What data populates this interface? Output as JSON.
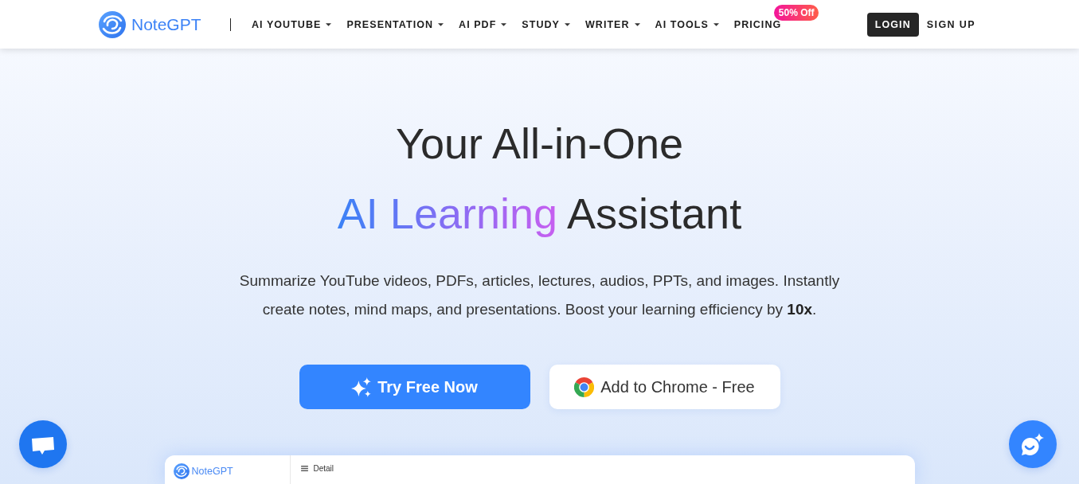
{
  "header": {
    "logo": "NoteGPT",
    "nav": [
      {
        "label": "AI YOUTUBE",
        "dropdown": true
      },
      {
        "label": "PRESENTATION",
        "dropdown": true
      },
      {
        "label": "AI PDF",
        "dropdown": true
      },
      {
        "label": "STUDY",
        "dropdown": true
      },
      {
        "label": "WRITER",
        "dropdown": true
      },
      {
        "label": "AI TOOLS",
        "dropdown": true
      },
      {
        "label": "PRICING",
        "dropdown": false,
        "badge": "50% Off"
      }
    ],
    "auth": {
      "login": "LOGIN",
      "signup": "SIGN UP"
    }
  },
  "hero": {
    "title_lines": [
      [
        {
          "text": "Your All-in-One",
          "kind": "plain"
        }
      ],
      [
        {
          "text": "AI Learning",
          "kind": "gradient"
        },
        {
          "text": "Assistant",
          "kind": "plain"
        }
      ]
    ],
    "description": "Summarize YouTube videos, PDFs, articles, lectures, audios, PPTs, and images. Instantly create notes, mind maps, and presentations. Boost your learning efficiency by **10x**.",
    "buttons": [
      {
        "label": "Try Free Now",
        "kind": "primary"
      },
      {
        "label": "Add to Chrome - Free",
        "kind": "secondary"
      }
    ]
  },
  "preview": {
    "logo": "NoteGPT",
    "header_title": "Detail"
  }
}
